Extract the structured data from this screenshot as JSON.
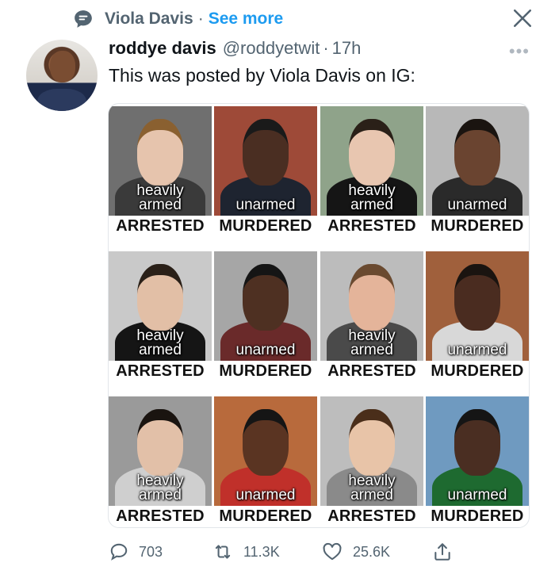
{
  "retweet_line": {
    "user": "Viola Davis",
    "separator": "·",
    "action": "See more"
  },
  "tweet": {
    "display_name": "roddye davis",
    "handle": "@roddyetwit",
    "separator": "·",
    "time": "17h",
    "text": "This was posted by Viola Davis on IG:"
  },
  "grid": {
    "rows": [
      {
        "cells": [
          {
            "label_lines": [
              "heavily",
              "armed"
            ],
            "caption": "ARRESTED",
            "bg": "#6f6f6f",
            "skin": "#e6c4ad",
            "hair": "#8a6030",
            "shirt": "#3a3a3a"
          },
          {
            "label_lines": [
              "unarmed"
            ],
            "caption": "MURDERED",
            "bg": "#9e4a38",
            "skin": "#4a2e22",
            "hair": "#1a1a1a",
            "shirt": "#1e2430"
          },
          {
            "label_lines": [
              "heavily",
              "armed"
            ],
            "caption": "ARRESTED",
            "bg": "#8fa38a",
            "skin": "#e8c6b0",
            "hair": "#2a2018",
            "shirt": "#151515"
          },
          {
            "label_lines": [
              "unarmed"
            ],
            "caption": "MURDERED",
            "bg": "#b8b8b8",
            "skin": "#6a4430",
            "hair": "#1a1410",
            "shirt": "#2a2a2a"
          }
        ]
      },
      {
        "cells": [
          {
            "label_lines": [
              "heavily",
              "armed"
            ],
            "caption": "ARRESTED",
            "bg": "#c9c9c9",
            "skin": "#e2bfa6",
            "hair": "#2a2018",
            "shirt": "#151515"
          },
          {
            "label_lines": [
              "unarmed"
            ],
            "caption": "MURDERED",
            "bg": "#a6a6a6",
            "skin": "#4e3022",
            "hair": "#151515",
            "shirt": "#6a2a2a"
          },
          {
            "label_lines": [
              "heavily",
              "armed"
            ],
            "caption": "ARRESTED",
            "bg": "#bcbcbc",
            "skin": "#e4b49a",
            "hair": "#6a4a30",
            "shirt": "#4a4a4a"
          },
          {
            "label_lines": [
              "unarmed"
            ],
            "caption": "MURDERED",
            "bg": "#a0603c",
            "skin": "#4a2c20",
            "hair": "#1a1410",
            "shirt": "#d8d8d8"
          }
        ]
      },
      {
        "cells": [
          {
            "label_lines": [
              "heavily",
              "armed"
            ],
            "caption": "ARRESTED",
            "bg": "#9a9a9a",
            "skin": "#e2c0a8",
            "hair": "#1a1410",
            "shirt": "#cfcfcf"
          },
          {
            "label_lines": [
              "unarmed"
            ],
            "caption": "MURDERED",
            "bg": "#b86a3c",
            "skin": "#5a3422",
            "hair": "#151515",
            "shirt": "#c0302a"
          },
          {
            "label_lines": [
              "heavily",
              "armed"
            ],
            "caption": "ARRESTED",
            "bg": "#bdbdbd",
            "skin": "#e8c4a8",
            "hair": "#4a2e1a",
            "shirt": "#8a8a8a"
          },
          {
            "label_lines": [
              "unarmed"
            ],
            "caption": "MURDERED",
            "bg": "#6f9ac0",
            "skin": "#4a2e22",
            "hair": "#151515",
            "shirt": "#1e6a30"
          }
        ]
      }
    ]
  },
  "actions": {
    "replies": "703",
    "retweets": "11.3K",
    "likes": "25.6K"
  },
  "colors": {
    "accent": "#1d9bf0",
    "muted": "#536471"
  }
}
